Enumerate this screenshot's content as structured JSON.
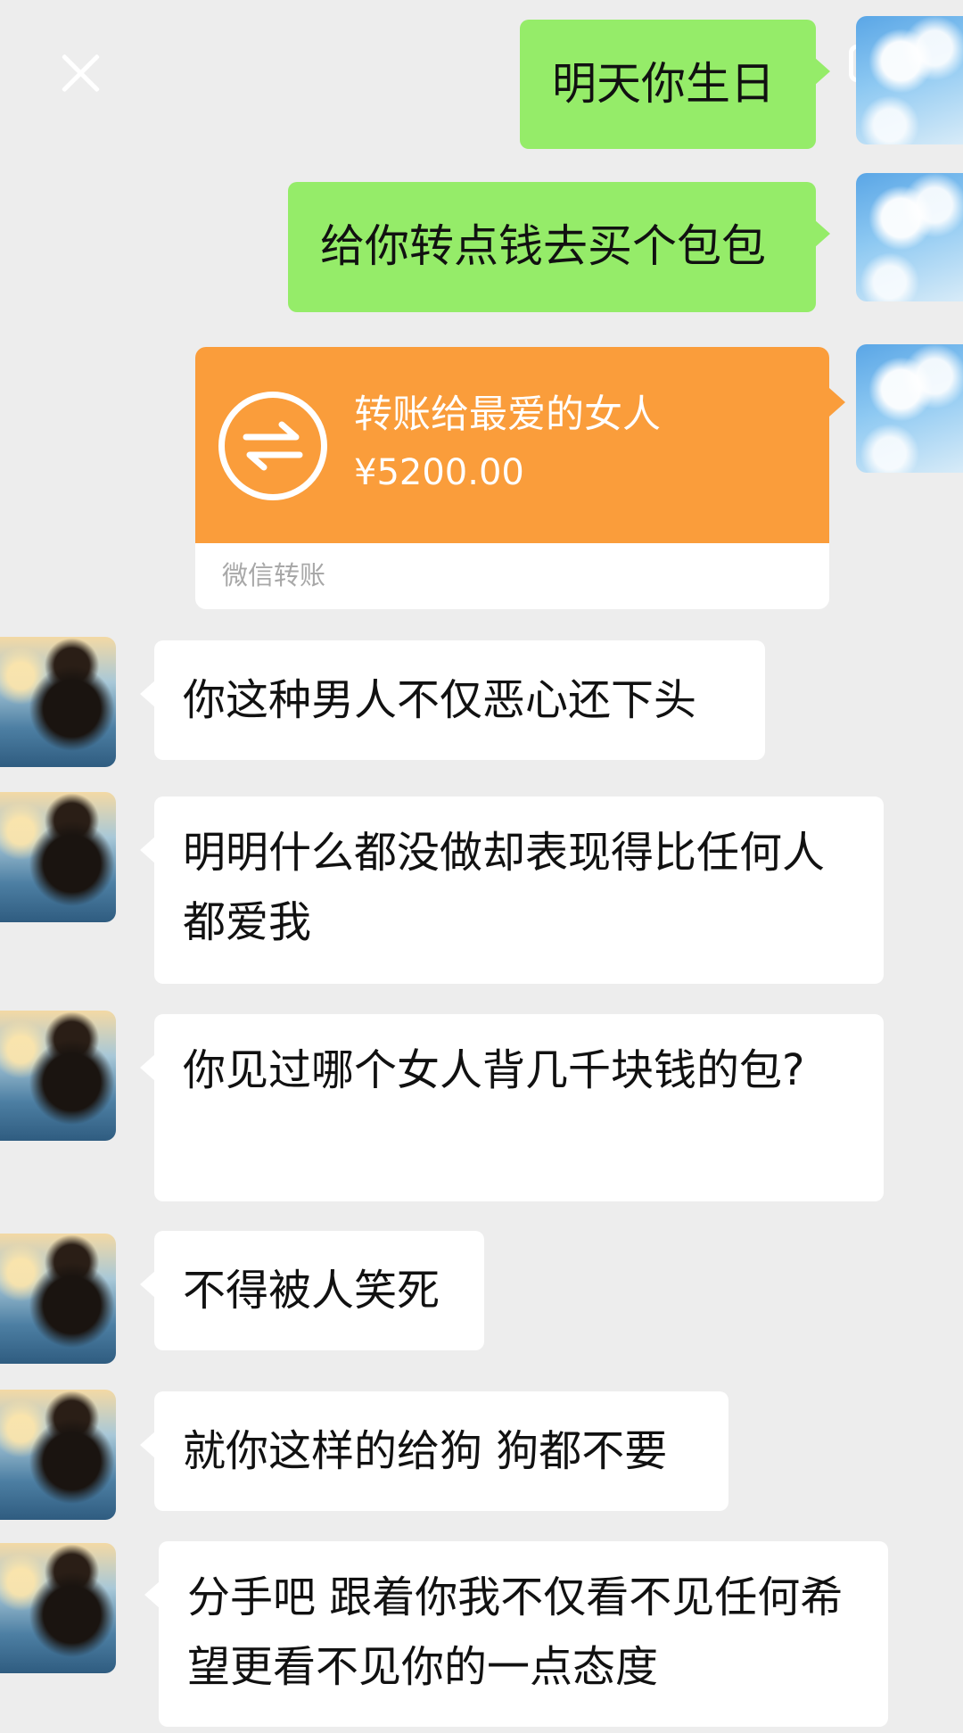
{
  "header": {
    "close_icon": "close-icon",
    "float_icon": "picture-in-picture-icon"
  },
  "colors": {
    "background": "#ededed",
    "sent_bubble": "#95ec69",
    "received_bubble": "#ffffff",
    "transfer_card": "#fa9d3b"
  },
  "messages": [
    {
      "side": "right",
      "text": "明天你生日"
    },
    {
      "side": "right",
      "text": "给你转点钱去买个包包"
    },
    {
      "side": "right",
      "type": "transfer",
      "title": "转账给最爱的女人",
      "amount": "¥5200.00",
      "footer": "微信转账",
      "icon": "transfer-arrows-icon"
    },
    {
      "side": "left",
      "text": "你这种男人不仅恶心还下头"
    },
    {
      "side": "left",
      "text": "明明什么都没做却表现得比任何人都爱我"
    },
    {
      "side": "left",
      "text": "你见过哪个女人背几千块钱的包?"
    },
    {
      "side": "left",
      "text": "不得被人笑死"
    },
    {
      "side": "left",
      "text": "就你这样的给狗 狗都不要"
    },
    {
      "side": "left",
      "text": "分手吧 跟着你我不仅看不见任何希望更看不见你的一点态度"
    }
  ]
}
